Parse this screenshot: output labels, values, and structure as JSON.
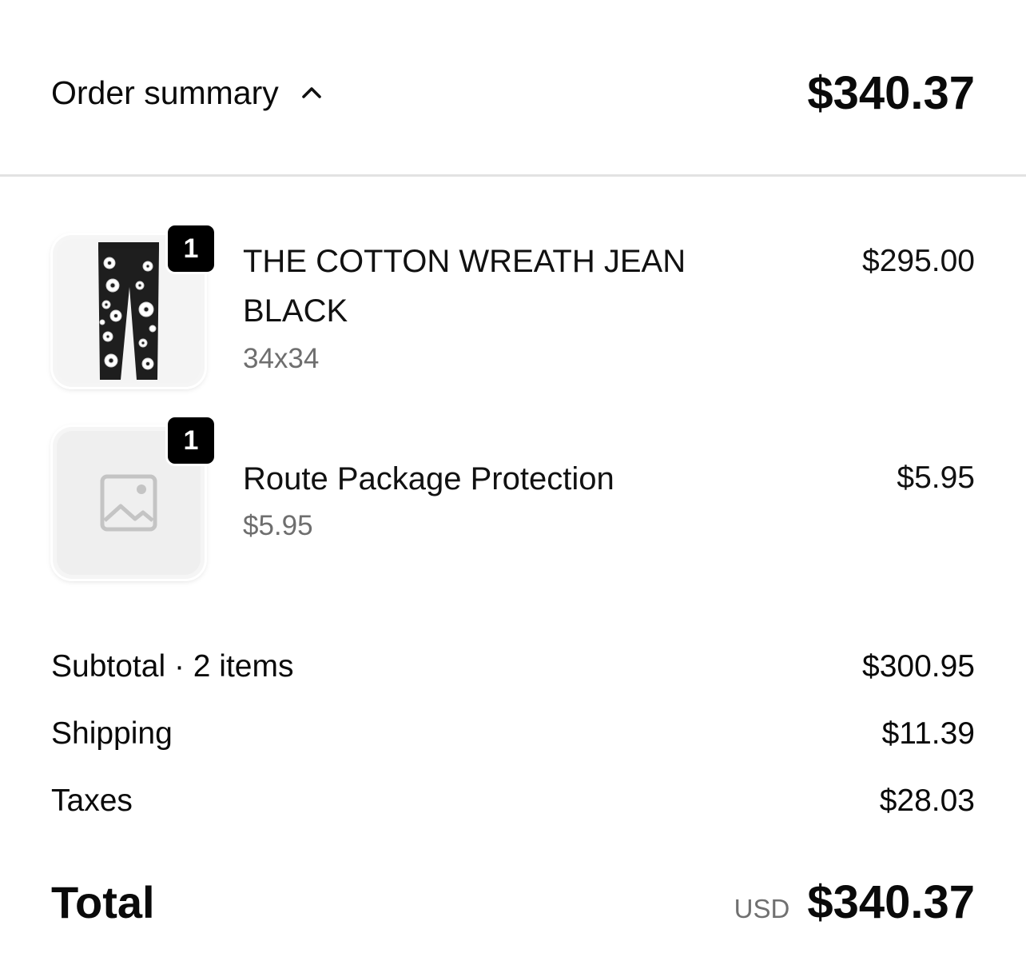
{
  "header": {
    "toggle_label": "Order summary",
    "toggle_icon": "chevron-up-icon",
    "total": "$340.37"
  },
  "items": [
    {
      "quantity": "1",
      "name_line1": "THE COTTON WREATH JEAN",
      "name_line2": "BLACK",
      "variant": "34x34",
      "price": "$295.00",
      "image": "black-jeans-with-white-flowers"
    },
    {
      "quantity": "1",
      "name_line1": "Route Package Protection",
      "variant": "$5.95",
      "price": "$5.95",
      "image": "image-placeholder-icon"
    }
  ],
  "summary": {
    "subtotal_label": "Subtotal · 2 items",
    "subtotal_value": "$300.95",
    "shipping_label": "Shipping",
    "shipping_value": "$11.39",
    "taxes_label": "Taxes",
    "taxes_value": "$28.03"
  },
  "total": {
    "label": "Total",
    "currency": "USD",
    "amount": "$340.37"
  },
  "colors": {
    "text": "#0a0a0a",
    "muted": "#6e6e6e",
    "divider": "#e2e2e2",
    "badge": "#000000"
  }
}
